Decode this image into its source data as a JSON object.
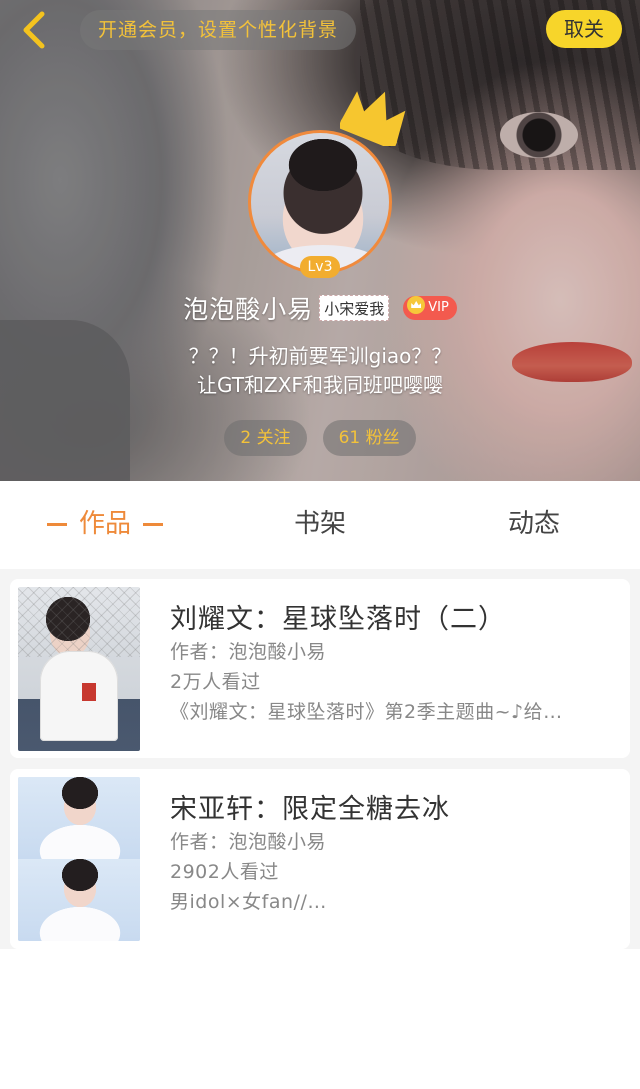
{
  "header": {
    "member_prompt": "开通会员，设置个性化背景",
    "follow_label": "取关"
  },
  "profile": {
    "level": "Lv3",
    "username": "泡泡酸小易",
    "name_tag": "小宋爱我",
    "vip_label": "VIP",
    "bio_lines": [
      "？？！升初前要军训giao？？",
      "让GT和ZXF和我同班吧嘤嘤"
    ],
    "following": "2 关注",
    "followers": "61 粉丝"
  },
  "tabs": [
    {
      "label": "作品",
      "active": true
    },
    {
      "label": "书架",
      "active": false
    },
    {
      "label": "动态",
      "active": false
    }
  ],
  "works": [
    {
      "title": "刘耀文：星球坠落时（二）",
      "author": "作者：泡泡酸小易",
      "views": "2万人看过",
      "desc": "《刘耀文：星球坠落时》第2季主题曲~♪给…"
    },
    {
      "title": "宋亚轩：限定全糖去冰",
      "author": "作者：泡泡酸小易",
      "views": "2902人看过",
      "desc": "男idol×女fan//…"
    }
  ],
  "colors": {
    "accent": "#ee8a3a",
    "follow_button": "#f7d52a",
    "pill_text": "#f3c23a",
    "vip_badge": "#f35a4e",
    "level_badge": "#f2ad2f"
  },
  "icons": [
    "back-arrow-icon",
    "crown-icon",
    "vip-crown-icon"
  ]
}
